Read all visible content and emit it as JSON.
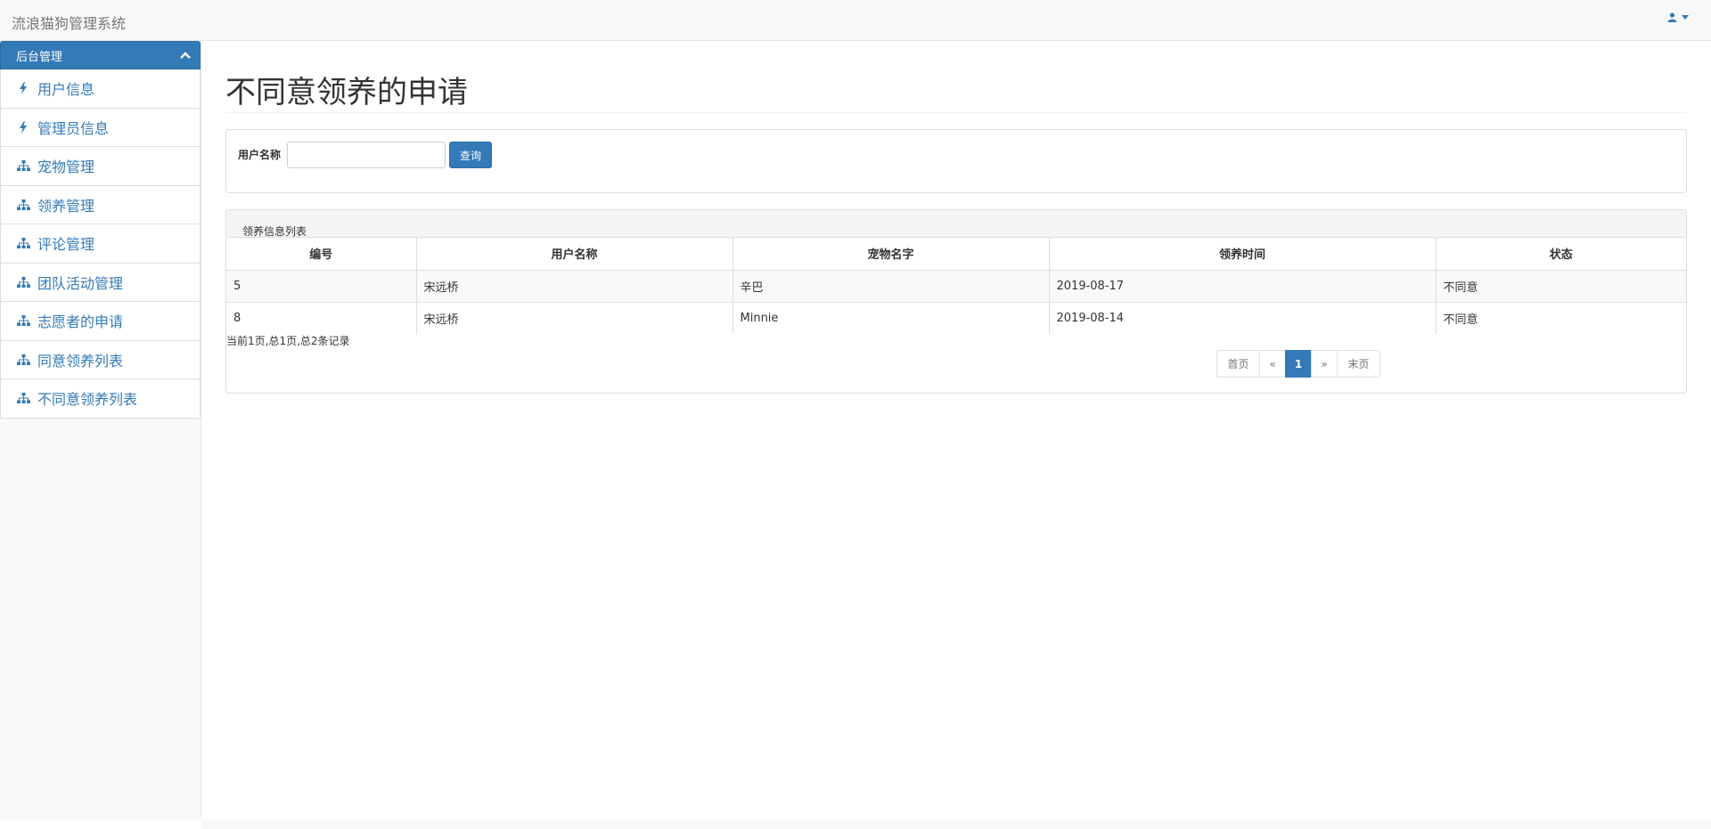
{
  "app": {
    "title": "流浪猫狗管理系统"
  },
  "sidebar": {
    "header": "后台管理",
    "items": [
      {
        "label": "用户信息",
        "icon": "bolt-icon"
      },
      {
        "label": "管理员信息",
        "icon": "bolt-icon"
      },
      {
        "label": "宠物管理",
        "icon": "sitemap-icon"
      },
      {
        "label": "领养管理",
        "icon": "sitemap-icon"
      },
      {
        "label": "评论管理",
        "icon": "sitemap-icon"
      },
      {
        "label": "团队活动管理",
        "icon": "sitemap-icon"
      },
      {
        "label": "志愿者的申请",
        "icon": "sitemap-icon"
      },
      {
        "label": "同意领养列表",
        "icon": "sitemap-icon"
      },
      {
        "label": "不同意领养列表",
        "icon": "sitemap-icon"
      }
    ]
  },
  "main": {
    "title": "不同意领养的申请",
    "search": {
      "label": "用户名称",
      "value": "",
      "button": "查询"
    },
    "list": {
      "title": "领养信息列表",
      "columns": [
        "编号",
        "用户名称",
        "宠物名字",
        "领养时间",
        "状态"
      ],
      "rows": [
        [
          "5",
          "宋远桥",
          "辛巴",
          "2019-08-17",
          "不同意"
        ],
        [
          "8",
          "宋远桥",
          "Minnie",
          "2019-08-14",
          "不同意"
        ]
      ],
      "page_info": "当前1页,总1页,总2条记录",
      "pager": {
        "first": "首页",
        "prev": "«",
        "current": "1",
        "next": "»",
        "last": "末页"
      }
    }
  },
  "colors": {
    "primary": "#337ab7",
    "navbar_bg": "#f8f8f8",
    "border": "#dddddd"
  }
}
